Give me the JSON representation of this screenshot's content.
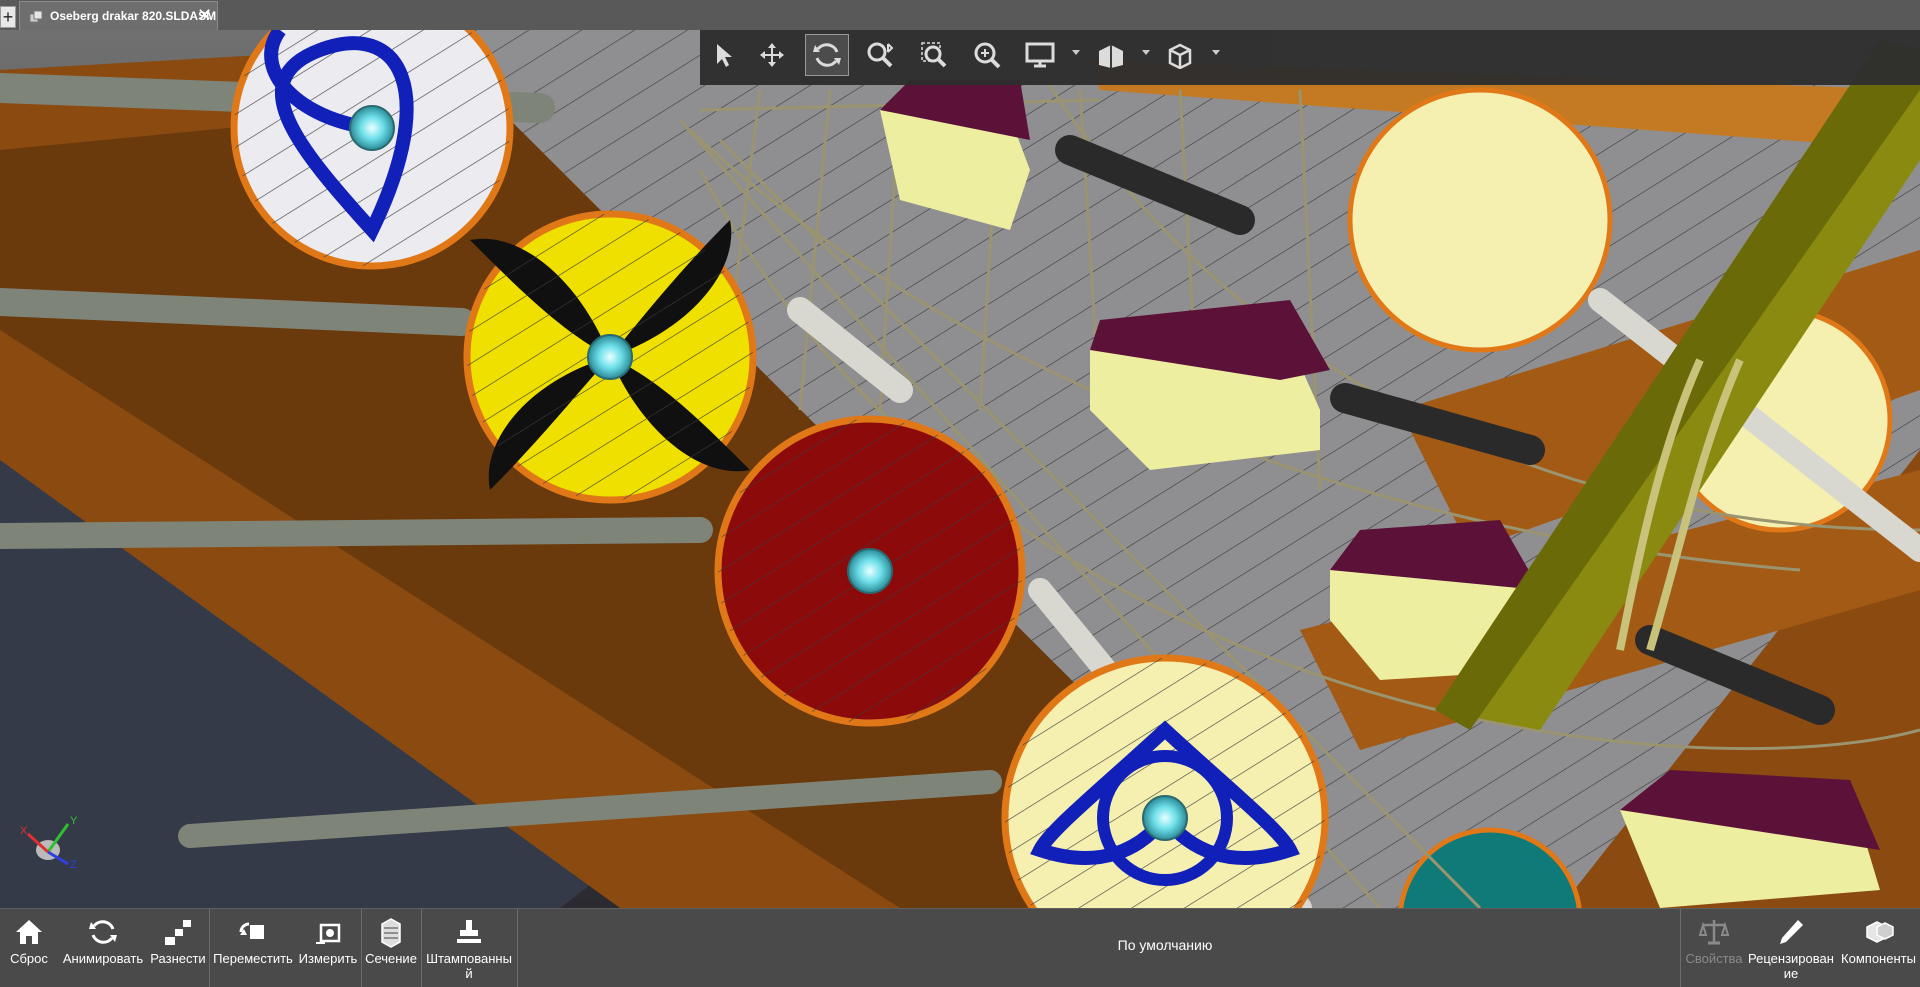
{
  "tabs": [
    {
      "title": "Oseberg drakar 820.SLDASM"
    }
  ],
  "new_tab_label": "+",
  "close_tab_label": "✕",
  "view_toolbar": [
    {
      "icon": "select-arrow-icon"
    },
    {
      "icon": "pan-move-icon"
    },
    {
      "icon": "rotate-icon",
      "active": true
    },
    {
      "icon": "zoom-fit-icon"
    },
    {
      "icon": "zoom-area-icon"
    },
    {
      "icon": "zoom-in-out-icon"
    },
    {
      "icon": "display-monitor-icon",
      "dropdown": true
    },
    {
      "icon": "display-style-icon",
      "dropdown": true
    },
    {
      "icon": "view-orientation-cube-icon",
      "dropdown": true
    }
  ],
  "triad": {
    "x": "X",
    "y": "Y",
    "z": "Z"
  },
  "bottom_toolbar": {
    "left": [
      {
        "label": "Сброс",
        "icon": "home-icon"
      },
      {
        "label": "Анимировать",
        "icon": "animate-cycle-icon"
      },
      {
        "label": "Разнести",
        "icon": "explode-icon"
      },
      {
        "label": "Переместить",
        "icon": "move-component-icon"
      },
      {
        "label": "Измерить",
        "icon": "measure-icon"
      },
      {
        "label": "Сечение",
        "icon": "section-view-icon"
      },
      {
        "label": "Штампованный",
        "icon": "stamp-icon"
      }
    ],
    "configuration": "По умолчанию",
    "right": [
      {
        "label": "Свойства",
        "icon": "scales-icon",
        "disabled": true
      },
      {
        "label": "Рецензирование",
        "icon": "pencil-icon"
      },
      {
        "label": "Компоненты",
        "icon": "components-icon"
      }
    ]
  },
  "colors": {
    "hull_wood": "#8a4a10",
    "hull_dark": "#5a2d08",
    "deck": "#8f8f92",
    "shield_yellow": "#f0e000",
    "shield_black": "#101010",
    "shield_red": "#8c0a0a",
    "shield_pale": "#f5f0b0",
    "shield_white": "#ececf0",
    "knot_blue": "#1020b8",
    "boss_cyan": "#6fe0ea",
    "mast": "#8a8a10",
    "rope": "#9a9470",
    "oar": "#7f8478",
    "chest_lid": "#5c1238",
    "chest_body": "#eeeea0"
  }
}
